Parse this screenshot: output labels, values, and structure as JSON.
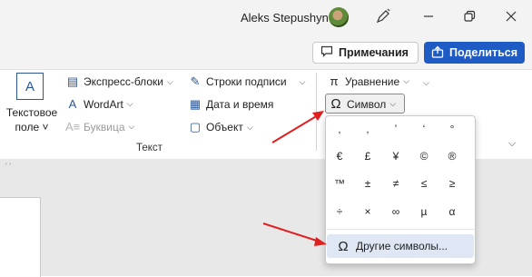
{
  "titlebar": {
    "user_name": "Aleks Stepushyn",
    "minimize_icon": "minimize-icon",
    "restore_icon": "restore-icon",
    "close_icon": "close-icon",
    "pen_icon": "pen-icon"
  },
  "header_buttons": {
    "comments_label": "Примечания",
    "share_label": "Поделиться",
    "accent_color": "#1f5bc4"
  },
  "ribbon": {
    "text_box": {
      "line1": "Текстовое",
      "line2": "поле ˅"
    },
    "items": {
      "quick_parts": "Экспресс-блоки",
      "wordart": "WordArt",
      "drop_cap": "Буквица",
      "signature_line": "Строки подписи",
      "date_time": "Дата и время",
      "object": "Объект",
      "equation": "Уравнение",
      "symbol": "Символ"
    },
    "group_label": "Текст",
    "ruler_marks": "'   '"
  },
  "symbol_panel": {
    "rows": [
      [
        "‚",
        "‚",
        "’",
        "‘",
        "°"
      ],
      [
        "€",
        "£",
        "¥",
        "©",
        "®"
      ],
      [
        "™",
        "±",
        "≠",
        "≤",
        "≥"
      ],
      [
        "÷",
        "×",
        "∞",
        "µ",
        "α"
      ]
    ],
    "more_symbols_label": "Другие символы..."
  },
  "annotations": {
    "arrow_color": "#e02020"
  }
}
